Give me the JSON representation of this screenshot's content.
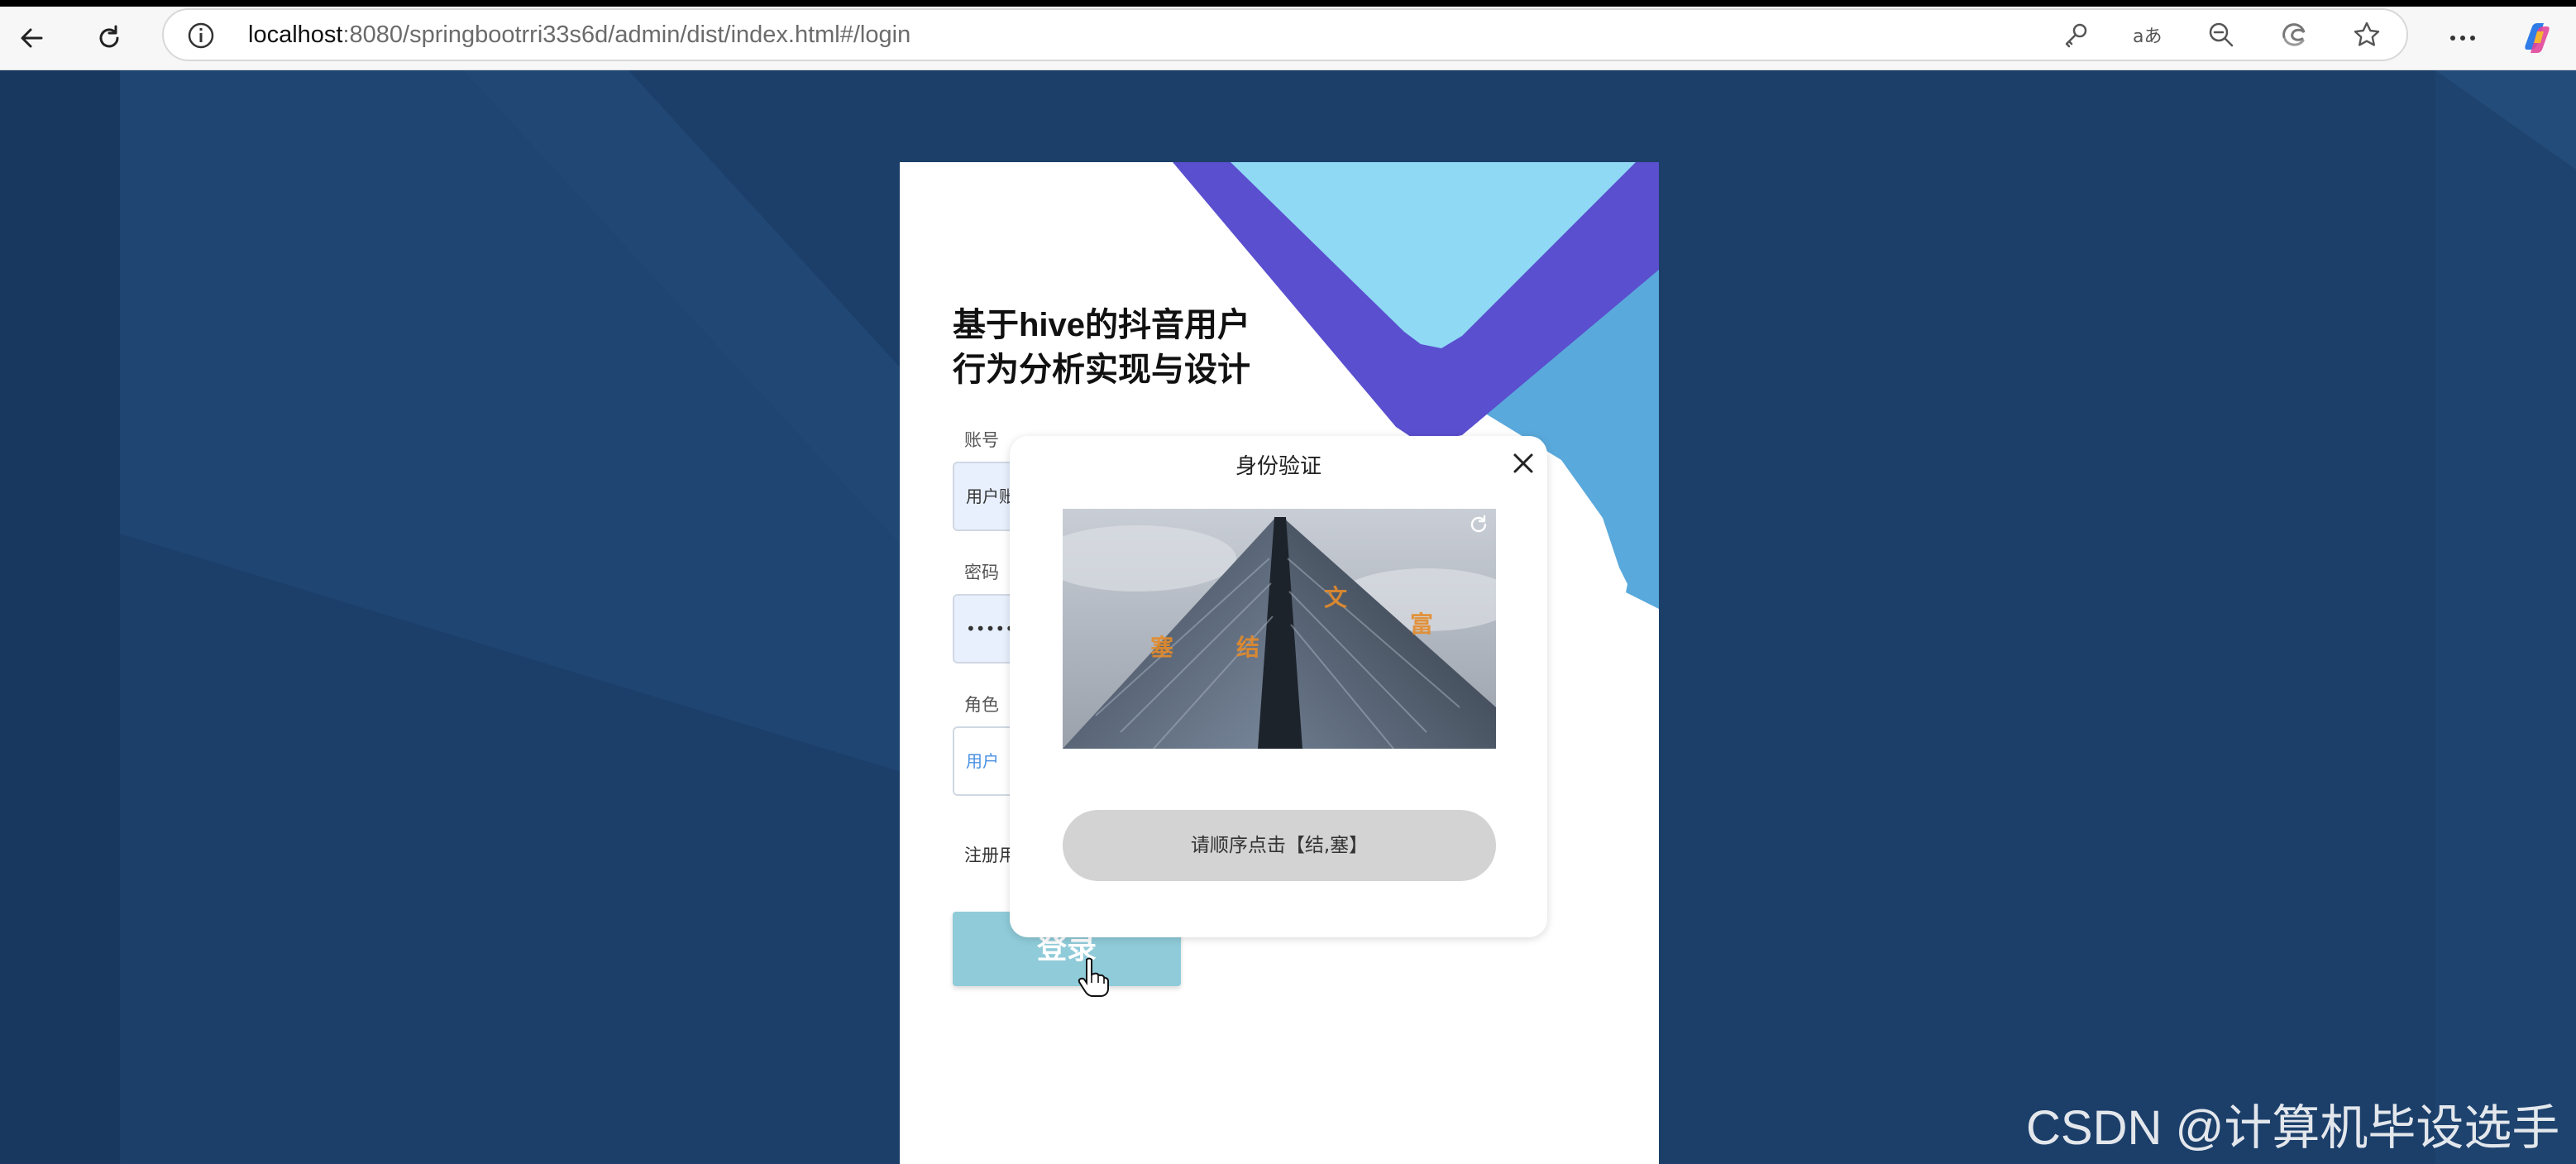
{
  "browser": {
    "url_host": "localhost",
    "url_rest": ":8080/springbootrri33s6d/admin/dist/index.html#/login",
    "icons": [
      "back-icon",
      "reload-icon",
      "site-info-icon",
      "key-icon",
      "read-aloud-icon",
      "zoom-out-icon",
      "edge-sync-icon",
      "favorite-star-icon",
      "more-icon",
      "copilot-icon"
    ]
  },
  "card": {
    "title_line1": "基于hive的抖音用户",
    "title_line2": "行为分析实现与设计",
    "account_label": "账号",
    "account_placeholder": "用户账",
    "password_label": "密码",
    "password_value": "••••••",
    "role_label": "角色",
    "role_value": "用户",
    "register_link": "注册用",
    "login_button": "登录"
  },
  "dialog": {
    "title": "身份验证",
    "captcha_chars": [
      "塞",
      "结",
      "文",
      "富"
    ],
    "hint": "请顺序点击【结,塞】"
  },
  "watermark": "CSDN @计算机毕设选手",
  "colors": {
    "page_bg": "#1a3a64",
    "accent_light_blue": "#8fd9f5",
    "accent_purple": "#5a4fcf",
    "accent_blue": "#5aa9dc",
    "login_button": "#8fcbd9"
  }
}
